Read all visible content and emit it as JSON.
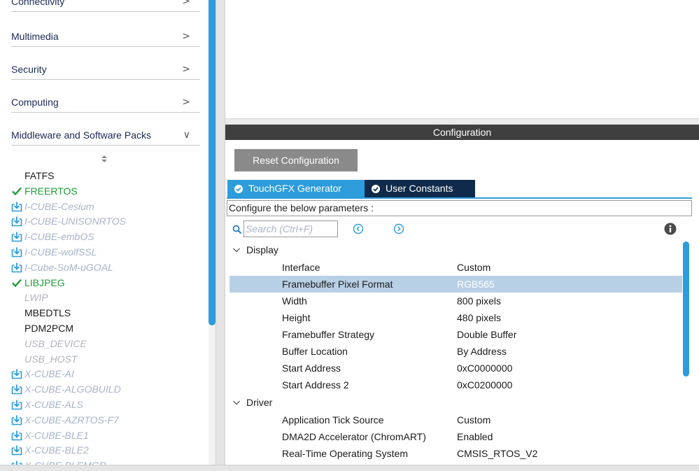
{
  "sidebar": {
    "categories": [
      {
        "label": "Connectivity",
        "chevron": ">"
      },
      {
        "label": "Multimedia",
        "chevron": ">"
      },
      {
        "label": "Security",
        "chevron": ">"
      },
      {
        "label": "Computing",
        "chevron": ">"
      },
      {
        "label": "Middleware and Software Packs",
        "chevron": "∨"
      }
    ],
    "packs": [
      {
        "label": "FATFS",
        "state": "normal"
      },
      {
        "label": "FREERTOS",
        "state": "installed"
      },
      {
        "label": "I-CUBE-Cesium",
        "state": "download"
      },
      {
        "label": "I-CUBE-UNISONRTOS",
        "state": "download"
      },
      {
        "label": "I-CUBE-embOS",
        "state": "download"
      },
      {
        "label": "I-CUBE-wolfSSL",
        "state": "download"
      },
      {
        "label": "I-Cube-SoM-uGOAL",
        "state": "download"
      },
      {
        "label": "LIBJPEG",
        "state": "installed"
      },
      {
        "label": "LWIP",
        "state": "disabled"
      },
      {
        "label": "MBEDTLS",
        "state": "normal"
      },
      {
        "label": "PDM2PCM",
        "state": "normal"
      },
      {
        "label": "USB_DEVICE",
        "state": "disabled"
      },
      {
        "label": "USB_HOST",
        "state": "disabled"
      },
      {
        "label": "X-CUBE-AI",
        "state": "download"
      },
      {
        "label": "X-CUBE-ALGOBUILD",
        "state": "download"
      },
      {
        "label": "X-CUBE-ALS",
        "state": "download"
      },
      {
        "label": "X-CUBE-AZRTOS-F7",
        "state": "download"
      },
      {
        "label": "X-CUBE-BLE1",
        "state": "download"
      },
      {
        "label": "X-CUBE-BLE2",
        "state": "download"
      },
      {
        "label": "X-CUBE-BLEMGR",
        "state": "download"
      }
    ]
  },
  "config": {
    "header": "Configuration",
    "reset_label": "Reset Configuration",
    "tabs": [
      {
        "label": "TouchGFX Generator",
        "active": true
      },
      {
        "label": "User Constants",
        "active": false
      }
    ],
    "instruction": "Configure the below parameters :",
    "search_placeholder": "Search (Ctrl+F)",
    "groups": [
      {
        "label": "Display",
        "params": [
          {
            "name": "Interface",
            "value": "Custom"
          },
          {
            "name": "Framebuffer Pixel Format",
            "value": "RGB565",
            "selected": true
          },
          {
            "name": "Width",
            "value": "800 pixels"
          },
          {
            "name": "Height",
            "value": "480 pixels"
          },
          {
            "name": "Framebuffer Strategy",
            "value": "Double Buffer"
          },
          {
            "name": "Buffer Location",
            "value": "By Address"
          },
          {
            "name": "Start Address",
            "value": "0xC0000000"
          },
          {
            "name": "Start Address 2",
            "value": "0xC0200000"
          }
        ]
      },
      {
        "label": "Driver",
        "params": [
          {
            "name": "Application Tick Source",
            "value": "Custom"
          },
          {
            "name": "DMA2D Accelerator (ChromART)",
            "value": "Enabled"
          },
          {
            "name": "Real-Time Operating System",
            "value": "CMSIS_RTOS_V2"
          }
        ]
      }
    ]
  },
  "colors": {
    "accent": "#2d9cdb",
    "header_bg": "#3f3f3f",
    "installed_green": "#1f9b3a",
    "selected_row": "#b8d0e6",
    "tab_dark": "#0f2a4a"
  },
  "icons": {
    "installed": "check-icon",
    "download": "download-box-icon",
    "sort": "sort-arrows-icon",
    "search": "search-icon",
    "prev": "previous-circle-icon",
    "next": "next-circle-icon",
    "info": "info-icon",
    "group_toggle": "chevron-down-icon"
  }
}
